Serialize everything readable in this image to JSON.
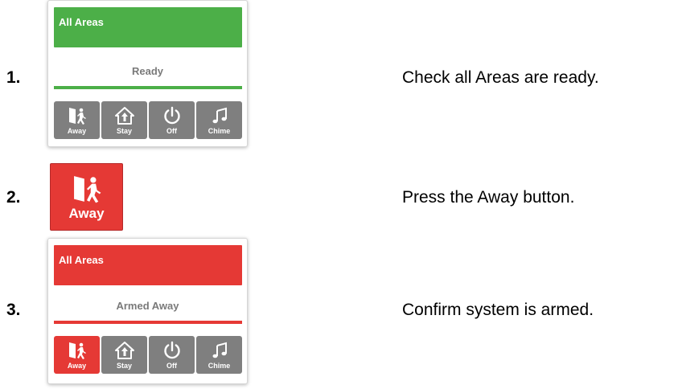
{
  "colors": {
    "ready": "#4caf48",
    "armed": "#e53935",
    "button_grey": "#7f7f7f",
    "status_text": "#7a7a7a"
  },
  "steps": [
    {
      "number": "1.",
      "instruction": "Check all Areas are ready.",
      "panel": {
        "header": "All Areas",
        "status": "Ready",
        "buttons": [
          {
            "label": "Away",
            "icon": "away-door-icon",
            "active": false
          },
          {
            "label": "Stay",
            "icon": "stay-home-icon",
            "active": false
          },
          {
            "label": "Off",
            "icon": "power-icon",
            "active": false
          },
          {
            "label": "Chime",
            "icon": "music-note-icon",
            "active": false
          }
        ]
      }
    },
    {
      "number": "2.",
      "instruction": "Press the Away button.",
      "button": {
        "label": "Away",
        "icon": "away-door-icon"
      }
    },
    {
      "number": "3.",
      "instruction": "Confirm system is armed.",
      "panel": {
        "header": "All Areas",
        "status": "Armed Away",
        "buttons": [
          {
            "label": "Away",
            "icon": "away-door-icon",
            "active": true
          },
          {
            "label": "Stay",
            "icon": "stay-home-icon",
            "active": false
          },
          {
            "label": "Off",
            "icon": "power-icon",
            "active": false
          },
          {
            "label": "Chime",
            "icon": "music-note-icon",
            "active": false
          }
        ]
      }
    }
  ]
}
